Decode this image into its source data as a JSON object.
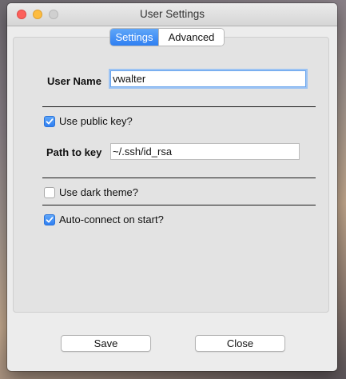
{
  "window": {
    "title": "User Settings"
  },
  "tabs": [
    {
      "label": "Settings",
      "active": true
    },
    {
      "label": "Advanced",
      "active": false
    }
  ],
  "form": {
    "user_name": {
      "label": "User Name",
      "value": "vwalter"
    },
    "use_public_key": {
      "label": "Use public key?",
      "checked": true
    },
    "path_to_key": {
      "label": "Path to key",
      "value": "~/.ssh/id_rsa"
    },
    "dark_theme": {
      "label": "Use dark theme?",
      "checked": false
    },
    "auto_connect": {
      "label": "Auto-connect on start?",
      "checked": true
    }
  },
  "buttons": {
    "save": "Save",
    "close": "Close"
  },
  "colors": {
    "accent": "#2f7ff2",
    "close_light": "#fc605b",
    "minimize_light": "#fdbc40"
  }
}
